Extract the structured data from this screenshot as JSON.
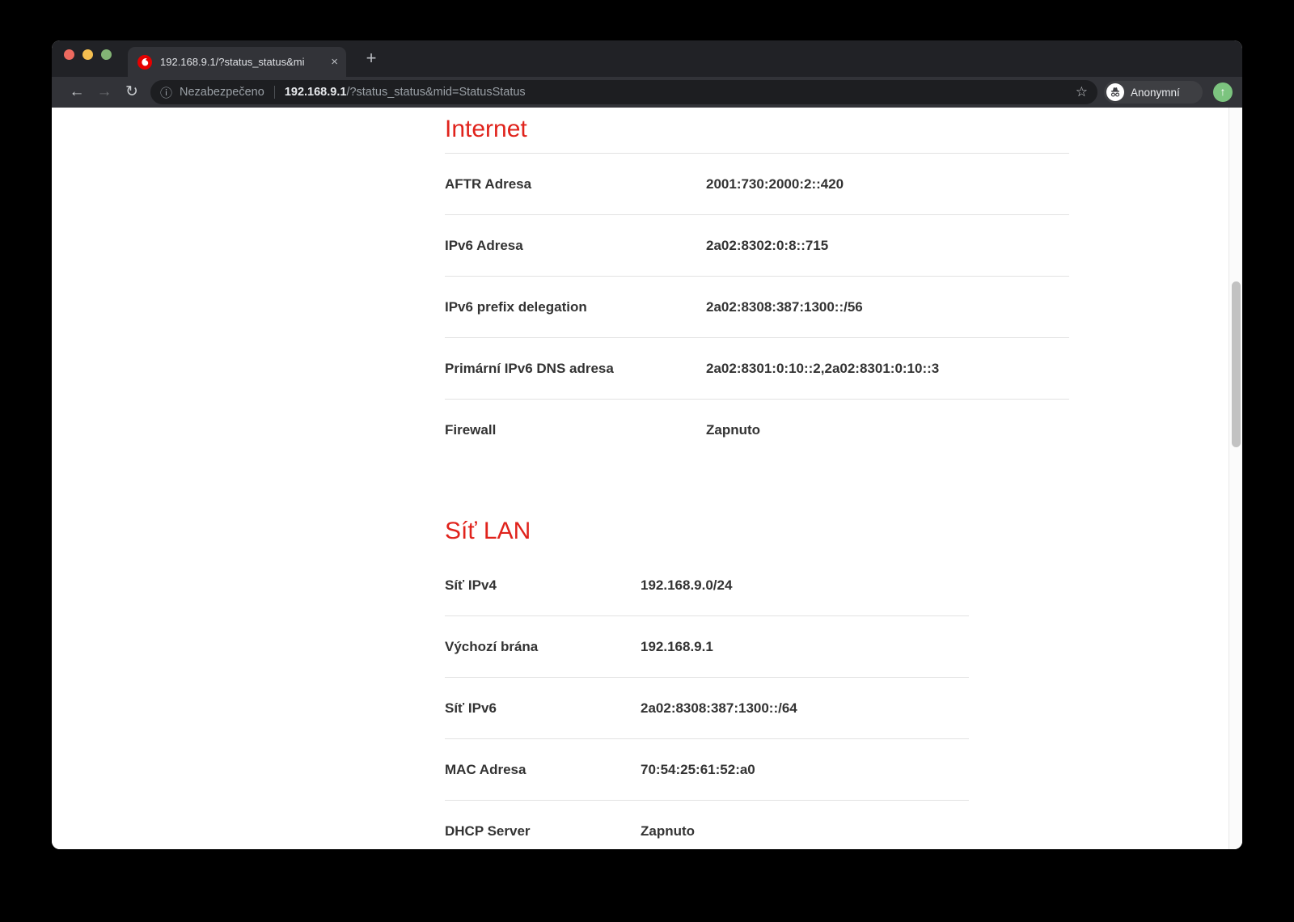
{
  "browser": {
    "tab": {
      "title": "192.168.9.1/?status_status&mi",
      "close_icon": "×",
      "favicon": "vodafone-logo"
    },
    "new_tab_icon": "+",
    "toolbar": {
      "back_icon": "←",
      "forward_icon": "→",
      "reload_icon": "↻",
      "security_info_icon": "ⓘ",
      "security_label": "Nezabezpečeno",
      "url_host": "192.168.9.1",
      "url_path": "/?status_status&mid=StatusStatus",
      "bookmark_icon": "☆",
      "incognito_label": "Anonymní",
      "extension_icon": "↑"
    }
  },
  "page": {
    "sections": [
      {
        "title": "Internet",
        "rows": [
          {
            "label": "AFTR Adresa",
            "value": "2001:730:2000:2::420"
          },
          {
            "label": "IPv6 Adresa",
            "value": "2a02:8302:0:8::715"
          },
          {
            "label": "IPv6 prefix delegation",
            "value": "2a02:8308:387:1300::/56"
          },
          {
            "label": "Primární IPv6 DNS adresa",
            "value": "2a02:8301:0:10::2,2a02:8301:0:10::3"
          },
          {
            "label": "Firewall",
            "value": "Zapnuto"
          }
        ]
      },
      {
        "title": "Síť LAN",
        "rows": [
          {
            "label": "Síť IPv4",
            "value": "192.168.9.0/24"
          },
          {
            "label": "Výchozí brána",
            "value": "192.168.9.1"
          },
          {
            "label": "Síť IPv6",
            "value": "2a02:8308:387:1300::/64"
          },
          {
            "label": "MAC Adresa",
            "value": "70:54:25:61:52:a0"
          },
          {
            "label": "DHCP Server",
            "value": "Zapnuto"
          }
        ]
      }
    ]
  },
  "colors": {
    "accent_red": "#e0231c",
    "vodafone_red": "#e60000",
    "tabstrip_bg": "#212226",
    "toolbar_bg": "#323338",
    "omnibox_bg": "#1d1e21",
    "divider": "#e2e2e2",
    "body_text": "#333333",
    "extension_green": "#7cc47f"
  }
}
